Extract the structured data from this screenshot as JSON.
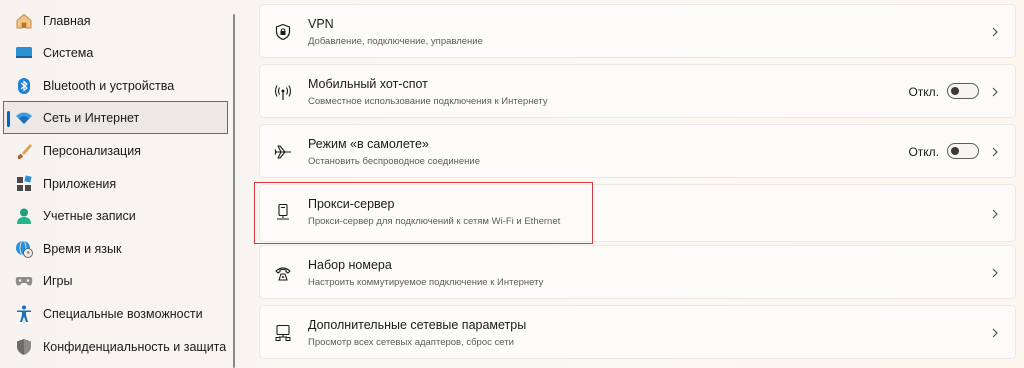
{
  "sidebar": {
    "items": [
      {
        "label": "Главная",
        "icon": "home-icon"
      },
      {
        "label": "Система",
        "icon": "system-icon"
      },
      {
        "label": "Bluetooth и устройства",
        "icon": "bluetooth-icon"
      },
      {
        "label": "Сеть и Интернет",
        "icon": "wifi-icon",
        "active": true
      },
      {
        "label": "Персонализация",
        "icon": "brush-icon"
      },
      {
        "label": "Приложения",
        "icon": "apps-icon"
      },
      {
        "label": "Учетные записи",
        "icon": "person-icon"
      },
      {
        "label": "Время и язык",
        "icon": "globe-clock-icon"
      },
      {
        "label": "Игры",
        "icon": "gamepad-icon"
      },
      {
        "label": "Специальные возможности",
        "icon": "accessibility-icon"
      },
      {
        "label": "Конфиденциальность и защита",
        "icon": "shield-icon"
      }
    ]
  },
  "cards": [
    {
      "title": "VPN",
      "subtitle": "Добавление, подключение, управление",
      "icon": "vpn-shield-icon"
    },
    {
      "title": "Мобильный хот-спот",
      "subtitle": "Совместное использование подключения к Интернету",
      "icon": "hotspot-icon",
      "toggle_label": "Откл.",
      "toggle_on": false
    },
    {
      "title": "Режим «в самолете»",
      "subtitle": "Остановить беспроводное соединение",
      "icon": "airplane-icon",
      "toggle_label": "Откл.",
      "toggle_on": false
    },
    {
      "title": "Прокси-сервер",
      "subtitle": "Прокси-сервер для подключений к сетям Wi-Fi и Ethernet",
      "icon": "proxy-icon"
    },
    {
      "title": "Набор номера",
      "subtitle": "Настроить коммутируемое подключение к Интернету",
      "icon": "dialup-icon"
    },
    {
      "title": "Дополнительные сетевые параметры",
      "subtitle": "Просмотр всех сетевых адаптеров, сброс сети",
      "icon": "network-pc-icon"
    }
  ],
  "colors": {
    "accent": "#0067c0",
    "highlight": "#d83b3b"
  }
}
